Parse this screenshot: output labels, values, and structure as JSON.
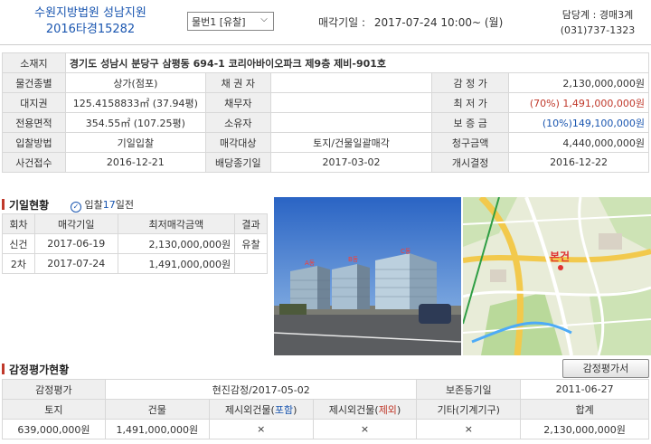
{
  "header": {
    "court": "수원지방법원 성남지원",
    "case_no": "2016타경15282",
    "item_select": "물번1 [유찰]",
    "auction_date_label": "매각기일 :",
    "auction_date": "2017-07-24  10:00~ (월)",
    "dept_label": "담당계 : 경매3계",
    "phone": "(031)737-1323"
  },
  "main_table": {
    "address_label": "소재지",
    "address": "경기도 성남시 분당구 삼평동 694-1 코리아바이오파크 제9층 제비-901호",
    "rows": [
      {
        "l1": "물건종별",
        "v1": "상가(점포)",
        "l2": "채 권 자",
        "v2": "",
        "l3": "감 정 가",
        "v3": "2,130,000,000원"
      },
      {
        "l1": "대지권",
        "v1": "125.4158833㎡ (37.94평)",
        "l2": "채무자",
        "v2": "",
        "l3": "최 저 가",
        "v3": "(70%) 1,491,000,000원"
      },
      {
        "l1": "전용면적",
        "v1": "354.55㎡ (107.25평)",
        "l2": "소유자",
        "v2": "",
        "l3": "보 증 금",
        "v3": "(10%)149,100,000원"
      },
      {
        "l1": "입찰방법",
        "v1": "기일입찰",
        "l2": "매각대상",
        "v2": "토지/건물일괄매각",
        "l3": "청구금액",
        "v3": "4,440,000,000원"
      },
      {
        "l1": "사건접수",
        "v1": "2016-12-21",
        "l2": "배당종기일",
        "v2": "2017-03-02",
        "l3": "개시결정",
        "v3": "2016-12-22"
      }
    ]
  },
  "history": {
    "title": "기일현황",
    "badge_prefix": "입찰",
    "badge_days": "17",
    "badge_suffix": "일전",
    "headers": [
      "회차",
      "매각기일",
      "최저매각금액",
      "결과"
    ],
    "rows": [
      {
        "round": "신건",
        "date": "2017-06-19",
        "amount": "2,130,000,000원",
        "result": "유찰"
      },
      {
        "round": "2차",
        "date": "2017-07-24",
        "amount": "1,491,000,000원",
        "result": ""
      }
    ]
  },
  "photo": {
    "labels": [
      "A동",
      "B동",
      "C동"
    ]
  },
  "map": {
    "marker_label": "본건"
  },
  "appraisal": {
    "title": "감정평가현황",
    "button": "감정평가서",
    "label": "감정평가",
    "agency": "현진감정/2017-05-02",
    "reg_label": "보존등기일",
    "reg_date": "2011-06-27",
    "headers": [
      "토지",
      "건물",
      "제시외건물(",
      "포함",
      ")",
      "제시외건물(",
      "제외",
      ")",
      "기타(기계기구)",
      "합계"
    ],
    "values": [
      "639,000,000원",
      "1,491,000,000원",
      "×",
      "×",
      "×",
      "2,130,000,000원"
    ]
  },
  "colors": {
    "accent": "#1a56b0",
    "red": "#c0392b"
  }
}
